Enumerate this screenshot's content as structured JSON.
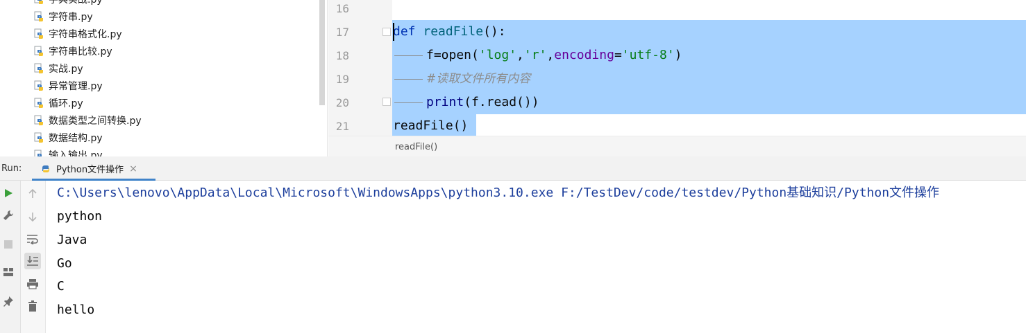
{
  "project_tree": {
    "files": [
      {
        "name": "字典实战.py"
      },
      {
        "name": "字符串.py"
      },
      {
        "name": "字符串格式化.py"
      },
      {
        "name": "字符串比较.py"
      },
      {
        "name": "实战.py"
      },
      {
        "name": "异常管理.py"
      },
      {
        "name": "循环.py"
      },
      {
        "name": "数据类型之间转换.py"
      },
      {
        "name": "数据结构.py"
      },
      {
        "name": "输入输出.py"
      }
    ]
  },
  "editor": {
    "lines": [
      {
        "num": "16"
      },
      {
        "num": "17",
        "def_kw": "def",
        "fn_name": "readFile",
        "tail": "():"
      },
      {
        "num": "18",
        "p1": "f=open(",
        "s1": "'log'",
        "c1": ",",
        "s2": "'r'",
        "c2": ",",
        "kwarg": "encoding",
        "eq": "=",
        "s3": "'utf-8'",
        "close": ")"
      },
      {
        "num": "19",
        "comment": "#读取文件所有内容"
      },
      {
        "num": "20",
        "print_kw": "print",
        "rest": "(f.read())"
      },
      {
        "num": "21",
        "call": "readFile()"
      }
    ],
    "breadcrumb": "readFile()"
  },
  "run_panel": {
    "label": "Run:",
    "tab_title": "Python文件操作",
    "tab_close": "×",
    "console_lines": [
      "C:\\Users\\lenovo\\AppData\\Local\\Microsoft\\WindowsApps\\python3.10.exe F:/TestDev/code/testdev/Python基础知识/Python文件操作",
      "python",
      "Java",
      "Go",
      "C",
      "hello"
    ]
  },
  "colors": {
    "selection": "#a6d2ff",
    "keyword": "#0033b3",
    "function": "#00627a",
    "string": "#067d17",
    "param": "#660099",
    "comment": "#8c8c8c",
    "builtin": "#000080",
    "run_green": "#3ba03b",
    "tab_underline": "#4083c9"
  },
  "icons": {
    "file": "python-file-icon",
    "run": "play-icon",
    "settings": "wrench-icon",
    "stop": "stop-icon",
    "layout": "layout-icon",
    "pin": "pin-icon",
    "up": "arrow-up-icon",
    "down": "arrow-down-icon",
    "wrap": "soft-wrap-icon",
    "scroll_end": "scroll-to-end-icon",
    "print": "print-icon",
    "trash": "trash-icon"
  }
}
